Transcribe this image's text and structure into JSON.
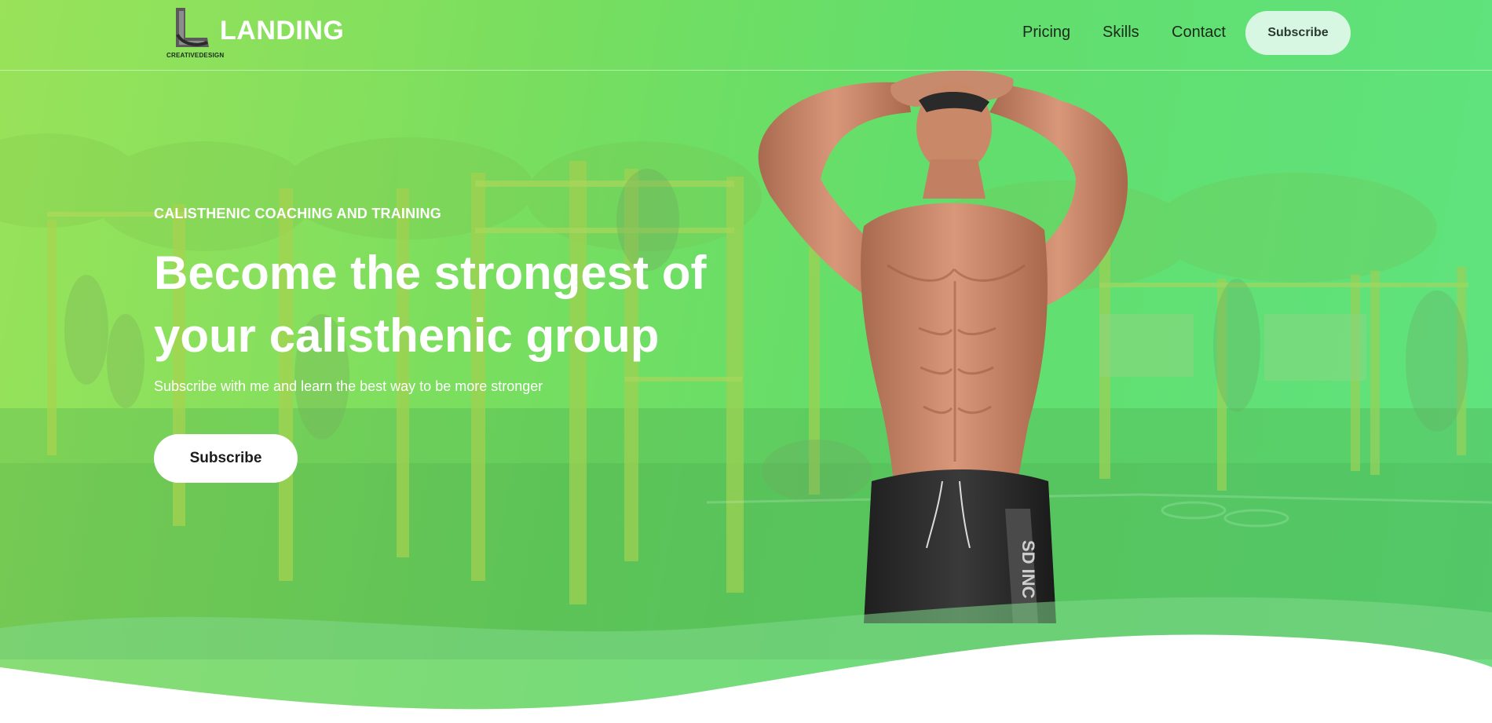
{
  "header": {
    "brand": "LANDING",
    "logo_sub": "CREATIVEDESIGN",
    "nav": {
      "pricing": "Pricing",
      "skills": "Skills",
      "contact": "Contact",
      "subscribe": "Subscribe"
    }
  },
  "hero": {
    "eyebrow": "CALISTHENIC COACHING AND TRAINING",
    "headline_line1": "Become the strongest of",
    "headline_line2": "your calisthenic group",
    "subline": "Subscribe with me and learn the best way to be more stronger",
    "cta": "Subscribe"
  },
  "icons": {
    "logo": "letter-l-logo-icon",
    "athlete": "athlete-photo",
    "scene": "outdoor-workout-park-photo"
  },
  "colors": {
    "accent_green": "#6fdc6a",
    "nav_button_bg": "#d8f7e2",
    "cta_bg": "#ffffff",
    "text_on_green": "#ffffff",
    "nav_text": "#1b2a1b"
  }
}
